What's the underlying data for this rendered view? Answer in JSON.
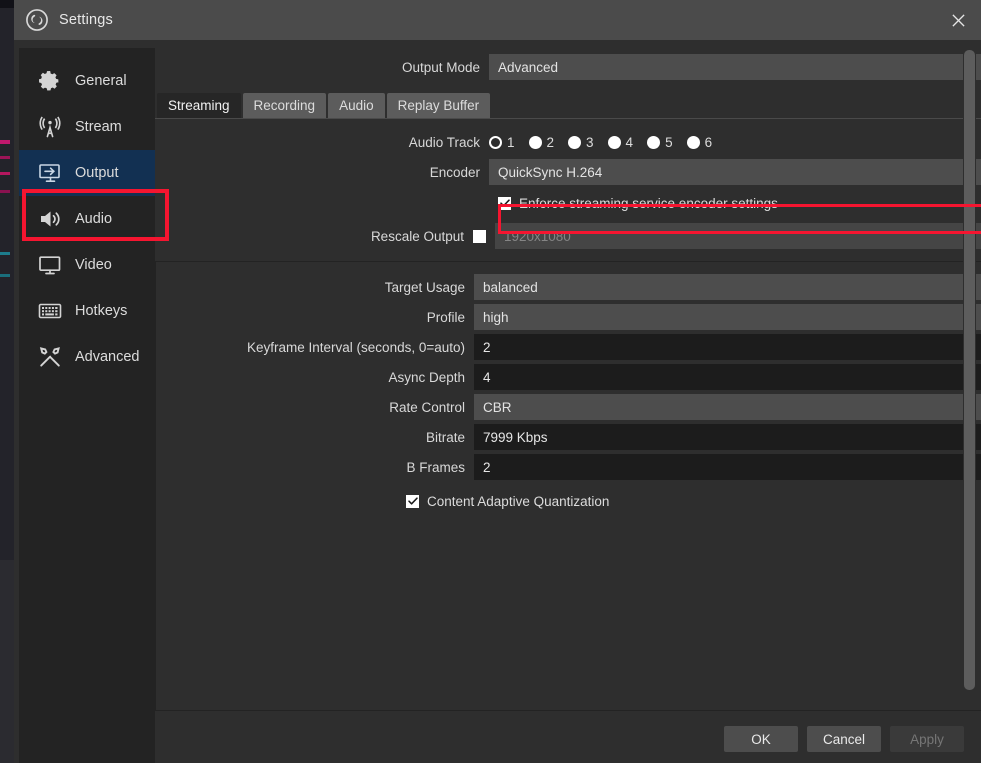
{
  "window": {
    "title": "Settings",
    "logo_icon": "obs-logo-icon",
    "close_icon": "close-icon"
  },
  "sidebar": {
    "items": [
      {
        "label": "General",
        "icon": "gear-icon",
        "selected": false
      },
      {
        "label": "Stream",
        "icon": "broadcast-icon",
        "selected": false
      },
      {
        "label": "Output",
        "icon": "monitor-arrow-icon",
        "selected": true
      },
      {
        "label": "Audio",
        "icon": "speaker-icon",
        "selected": false
      },
      {
        "label": "Video",
        "icon": "display-icon",
        "selected": false
      },
      {
        "label": "Hotkeys",
        "icon": "keyboard-icon",
        "selected": false
      },
      {
        "label": "Advanced",
        "icon": "tools-icon",
        "selected": false
      }
    ]
  },
  "output_mode": {
    "label": "Output Mode",
    "value": "Advanced"
  },
  "tabs": [
    {
      "label": "Streaming",
      "active": true
    },
    {
      "label": "Recording",
      "active": false
    },
    {
      "label": "Audio",
      "active": false
    },
    {
      "label": "Replay Buffer",
      "active": false
    }
  ],
  "audio_track": {
    "label": "Audio Track",
    "options": [
      "1",
      "2",
      "3",
      "4",
      "5",
      "6"
    ],
    "selected": "1"
  },
  "encoder": {
    "label": "Encoder",
    "value": "QuickSync H.264",
    "highlight_color": "#f51530"
  },
  "enforce": {
    "label": "Enforce streaming service encoder settings",
    "checked": true
  },
  "rescale": {
    "label": "Rescale Output",
    "checked": false,
    "value": "1920x1080",
    "disabled": true
  },
  "encoder_settings": {
    "fields": [
      {
        "label": "Target Usage",
        "value": "balanced",
        "type": "combo"
      },
      {
        "label": "Profile",
        "value": "high",
        "type": "combo"
      },
      {
        "label": "Keyframe Interval (seconds, 0=auto)",
        "value": "2",
        "type": "spin"
      },
      {
        "label": "Async Depth",
        "value": "4",
        "type": "spin"
      },
      {
        "label": "Rate Control",
        "value": "CBR",
        "type": "combo"
      },
      {
        "label": "Bitrate",
        "value": "7999 Kbps",
        "type": "spin"
      },
      {
        "label": "B Frames",
        "value": "2",
        "type": "spin"
      }
    ],
    "caq": {
      "label": "Content Adaptive Quantization",
      "checked": true
    }
  },
  "buttons": {
    "ok": "OK",
    "cancel": "Cancel",
    "apply": "Apply",
    "apply_disabled": true
  }
}
